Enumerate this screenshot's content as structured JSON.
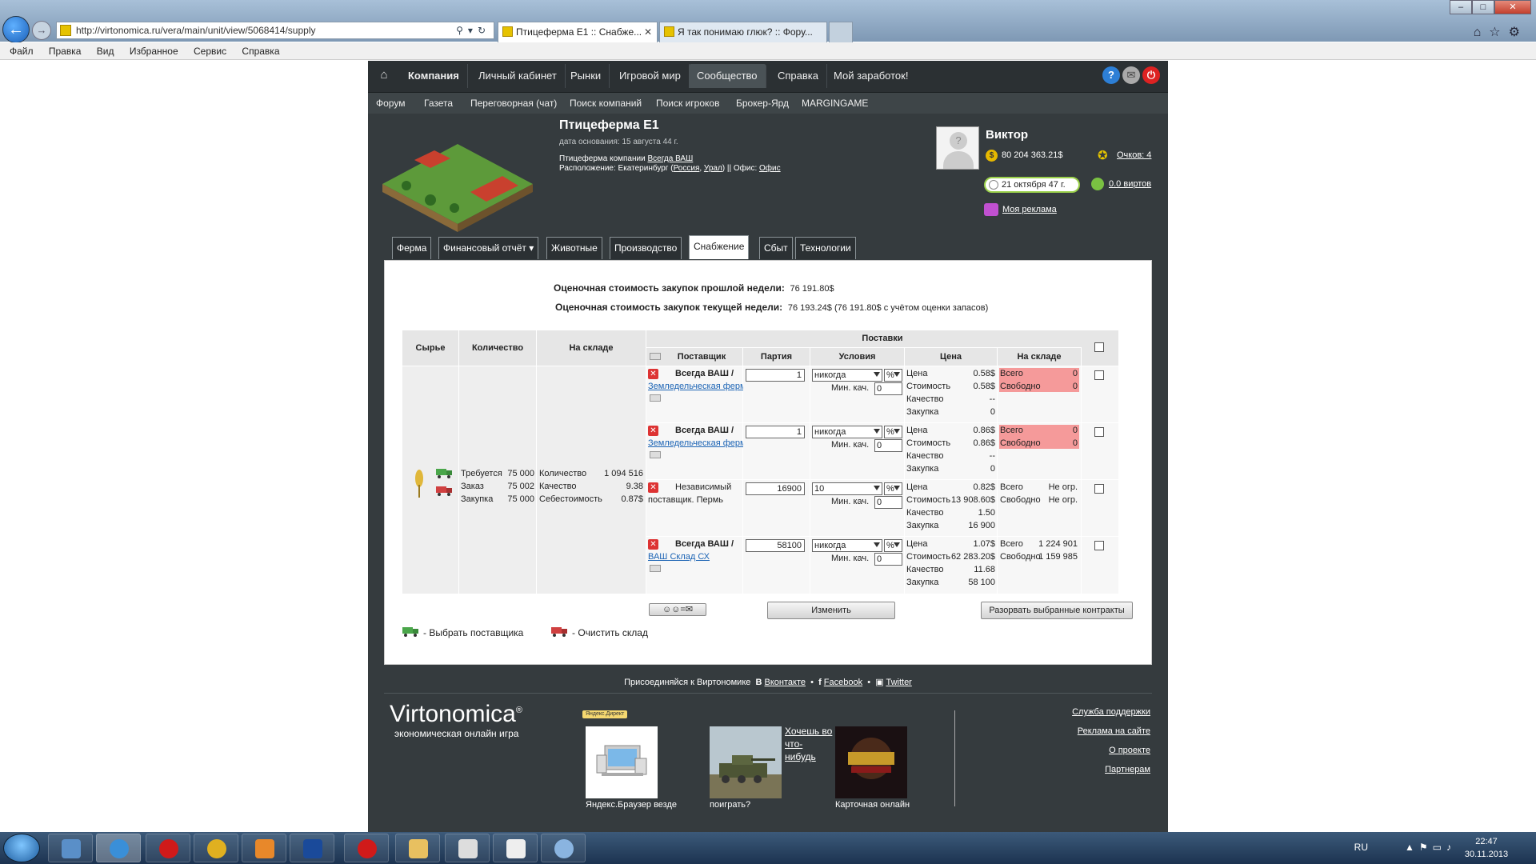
{
  "browser": {
    "url": "http://virtonomica.ru/vera/main/unit/view/5068414/supply",
    "tabs": [
      {
        "label": "Птицеферма Е1 :: Снабже..."
      },
      {
        "label": "Я так понимаю глюк? :: Фору..."
      }
    ],
    "menu": [
      "Файл",
      "Правка",
      "Вид",
      "Избранное",
      "Сервис",
      "Справка"
    ]
  },
  "topnav": {
    "items": [
      "Компания",
      "Личный кабинет",
      "Рынки",
      "Игровой мир",
      "Сообщество",
      "Справка",
      "Мой заработок!"
    ],
    "active": "Сообщество"
  },
  "subnav": {
    "items": [
      "Форум",
      "Газета",
      "Переговорная (чат)",
      "Поиск компаний",
      "Поиск игроков",
      "Брокер-Ярд",
      "MARGINGAME"
    ]
  },
  "unit": {
    "title": "Птицеферма Е1",
    "founded": "дата основания: 15 августа 44 г.",
    "company_prefix": "Птицеферма компании",
    "company_name": "Всегда ВАШ",
    "location_prefix": "Расположение: Екатеринбург (",
    "country": "Россия",
    "region": "Урал",
    "office_prefix": ") || Офис:",
    "office": "Офис"
  },
  "user": {
    "name": "Виктор",
    "money": "80 204 363.21$",
    "points": "Очков: 4",
    "date": "21 октября 47 г.",
    "virts": "0.0 виртов",
    "my_ad": "Моя реклама"
  },
  "unit_tabs": [
    "Ферма",
    "Финансовый отчёт",
    "Животные",
    "Производство",
    "Снабжение",
    "Сбыт",
    "Технологии"
  ],
  "summary": {
    "last_week_label": "Оценочная стоимость закупок прошлой недели:",
    "last_week_value": "76 191.80$",
    "this_week_label": "Оценочная стоимость закупок текущей недели:",
    "this_week_value": "76 193.24$ (76 191.80$ с учётом оценки запасов)"
  },
  "table": {
    "headers": {
      "raw": "Сырье",
      "qty": "Количество",
      "stock": "На складе",
      "supplies": "Поставки",
      "supplier": "Поставщик",
      "batch": "Партия",
      "terms": "Условия",
      "price": "Цена",
      "sup_stock": "На складе"
    },
    "need": {
      "required_label": "Требуется",
      "required": "75 000",
      "order_label": "Заказ",
      "order": "75 002",
      "purchase_label": "Закупка",
      "purchase": "75 000"
    },
    "stock": {
      "qty_label": "Количество",
      "qty": "1 094 516",
      "quality_label": "Качество",
      "quality": "9.38",
      "cost_label": "Себестоимость",
      "cost": "0.87$"
    },
    "min_q_label": "Мин. кач.",
    "rows": [
      {
        "supplier": "Всегда ВАШ /",
        "supplier_link": "Земледельческая ферма Е",
        "batch": "1",
        "terms": "никогда",
        "unit": "%",
        "min_q": "0",
        "price_label": "Цена",
        "price": "0.58$",
        "cost_label": "Стоимость",
        "cost": "0.58$",
        "quality_label": "Качество",
        "quality": "--",
        "purchase_label": "Закупка",
        "purchase": "0",
        "total_label": "Всего",
        "total": "0",
        "free_label": "Свободно",
        "free": "0"
      },
      {
        "supplier": "Всегда ВАШ /",
        "supplier_link": "Земледельческая ферма С",
        "batch": "1",
        "terms": "никогда",
        "unit": "%",
        "min_q": "0",
        "price_label": "Цена",
        "price": "0.86$",
        "cost_label": "Стоимость",
        "cost": "0.86$",
        "quality_label": "Качество",
        "quality": "--",
        "purchase_label": "Закупка",
        "purchase": "0",
        "total_label": "Всего",
        "total": "0",
        "free_label": "Свободно",
        "free": "0"
      },
      {
        "supplier": "Независимый",
        "supplier_line2": "поставщик. Пермь",
        "batch": "16900",
        "terms": "10",
        "unit": "%",
        "min_q": "0",
        "price_label": "Цена",
        "price": "0.82$",
        "cost_label": "Стоимость",
        "cost": "13 908.60$",
        "quality_label": "Качество",
        "quality": "1.50",
        "purchase_label": "Закупка",
        "purchase": "16 900",
        "total_label": "Всего",
        "total": "Не огр.",
        "free_label": "Свободно",
        "free": "Не огр."
      },
      {
        "supplier": "Всегда ВАШ /",
        "supplier_link": "ВАШ Склад СХ",
        "batch": "58100",
        "terms": "никогда",
        "unit": "%",
        "min_q": "0",
        "price_label": "Цена",
        "price": "1.07$",
        "cost_label": "Стоимость",
        "cost": "62 283.20$",
        "quality_label": "Качество",
        "quality": "11.68",
        "purchase_label": "Закупка",
        "purchase": "58 100",
        "total_label": "Всего",
        "total": "1 224 901",
        "free_label": "Свободно",
        "free": "1 159 985"
      }
    ],
    "change_button": "Изменить",
    "break_button": "Разорвать выбранные контракты"
  },
  "legend": {
    "choose_supplier": "- Выбрать поставщика",
    "clear_stock": "- Очистить склад"
  },
  "footer": {
    "join": "Присоединяйся к Виртономике",
    "vk": "Вконтакте",
    "facebook": "Facebook",
    "twitter": "Twitter",
    "logo": "Virtonomica",
    "tagline": "экономическая онлайн игра",
    "yandex": "Яндекс.Директ",
    "ad1": "Яндекс.Браузер везде",
    "ad2_title": "Хочешь во что-нибудь",
    "ad2": "поиграть?",
    "ad3": "Карточная онлайн",
    "links": [
      "Служба поддержки",
      "Реклама на сайте",
      "О проекте",
      "Партнерам"
    ]
  },
  "taskbar": {
    "lang": "RU",
    "time": "22:47",
    "date": "30.11.2013"
  },
  "colors": {
    "site_bg": "#353b3e",
    "link": "#1b63b4",
    "alert_red": "#f59a9a",
    "accent_green": "#9ad04a"
  }
}
